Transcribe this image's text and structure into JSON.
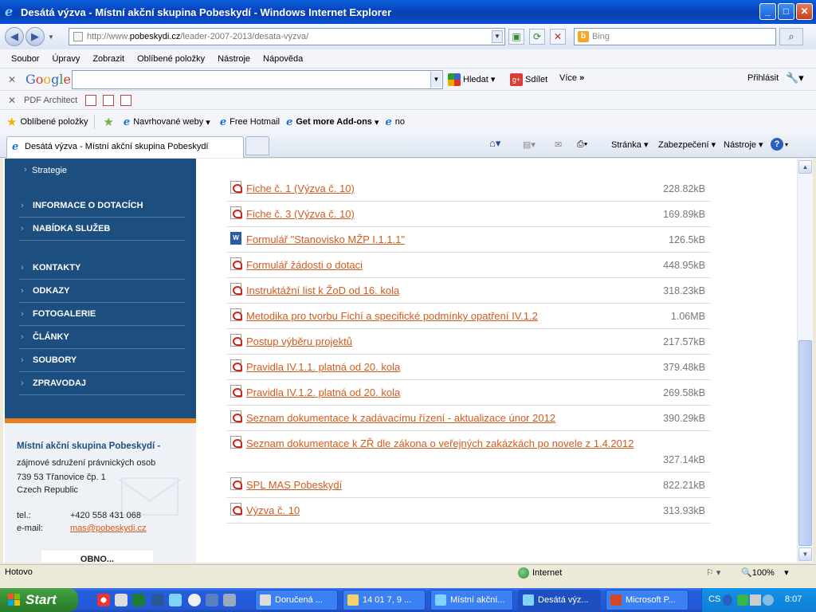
{
  "window": {
    "title": "Desátá výzva - Místní akční skupina Pobeskydí - Windows Internet Explorer"
  },
  "address": {
    "prefix": "http://www.",
    "domain": "pobeskydi.cz",
    "path": "/leader-2007-2013/desata-vyzva/"
  },
  "search": {
    "placeholder": "Bing"
  },
  "menu": [
    "Soubor",
    "Úpravy",
    "Zobrazit",
    "Oblíbené položky",
    "Nástroje",
    "Nápověda"
  ],
  "google": {
    "hledat": "Hledat",
    "sdilet": "Sdílet",
    "vice": "Více",
    "prihlasit": "Přihlásit"
  },
  "pdfbar": {
    "label": "PDF Architect"
  },
  "favorites": {
    "label": "Oblíbené položky",
    "items": [
      "Navrhované weby",
      "Free Hotmail",
      "Get more Add-ons",
      "no"
    ]
  },
  "tab": {
    "title": "Desátá výzva - Místní akční skupina Pobeskydí"
  },
  "commands": {
    "stranka": "Stránka",
    "zabezpeceni": "Zabezpečení",
    "nastroje": "Nástroje"
  },
  "sidebar": {
    "sub": "Strategie",
    "items": [
      "INFORMACE O DOTACÍCH",
      "NABÍDKA SLUŽEB",
      "KONTAKTY",
      "ODKAZY",
      "FOTOGALERIE",
      "ČLÁNKY",
      "SOUBORY",
      "ZPRAVODAJ"
    ],
    "contact": {
      "title": "Místní akční skupina Pobeskydí -",
      "line1": "zájmové sdružení právnických osob",
      "line2": "739 53 Třanovice čp. 1",
      "line3": "Czech Republic",
      "tel_label": "tel.:",
      "tel": "+420 558 431 068",
      "email_label": "e-mail:",
      "email": "mas@pobeskydi.cz",
      "obnov": "OBNO..."
    }
  },
  "files": [
    {
      "name": "Fiche č. 1 (Výzva č. 10)",
      "size": "228.82kB",
      "type": "pdf"
    },
    {
      "name": "Fiche č. 3 (Výzva č. 10)",
      "size": "169.89kB",
      "type": "pdf"
    },
    {
      "name": "Formulář \"Stanovisko MŽP I.1.1.1\"",
      "size": "126.5kB",
      "type": "doc"
    },
    {
      "name": "Formulář žádosti o dotaci",
      "size": "448.95kB",
      "type": "pdf"
    },
    {
      "name": "Instruktážní list k ŽoD od 16. kola",
      "size": "318.23kB",
      "type": "pdf"
    },
    {
      "name": "Metodika pro tvorbu Fichí a specifické podmínky opatření IV.1.2",
      "size": "1.06MB",
      "type": "pdf"
    },
    {
      "name": "Postup výběru projektů",
      "size": "217.57kB",
      "type": "pdf"
    },
    {
      "name": "Pravidla IV.1.1. platná od 20. kola",
      "size": "379.48kB",
      "type": "pdf"
    },
    {
      "name": "Pravidla IV.1.2. platná od 20. kola",
      "size": "269.58kB",
      "type": "pdf"
    },
    {
      "name": "Seznam dokumentace k zadávacímu řízení - aktualizace únor 2012",
      "size": "390.29kB",
      "type": "pdf"
    },
    {
      "name": "Seznam dokumentace k ZŘ dle zákona o veřejných zakázkách po novele z 1.4.2012",
      "size": "327.14kB",
      "type": "pdf",
      "wrap": true
    },
    {
      "name": "SPL MAS Pobeskydí",
      "size": "822.21kB",
      "type": "pdf"
    },
    {
      "name": "Výzva č. 10",
      "size": "313.93kB",
      "type": "pdf"
    }
  ],
  "status": {
    "text": "Hotovo",
    "zone": "Internet",
    "zoom": "100%"
  },
  "taskbar": {
    "start": "Start",
    "buttons": [
      "Doručená ...",
      "14 01 7, 9 ...",
      "Místní akční...",
      "Desátá výz...",
      "Microsoft P..."
    ],
    "lang": "CS",
    "clock": "8:07"
  }
}
